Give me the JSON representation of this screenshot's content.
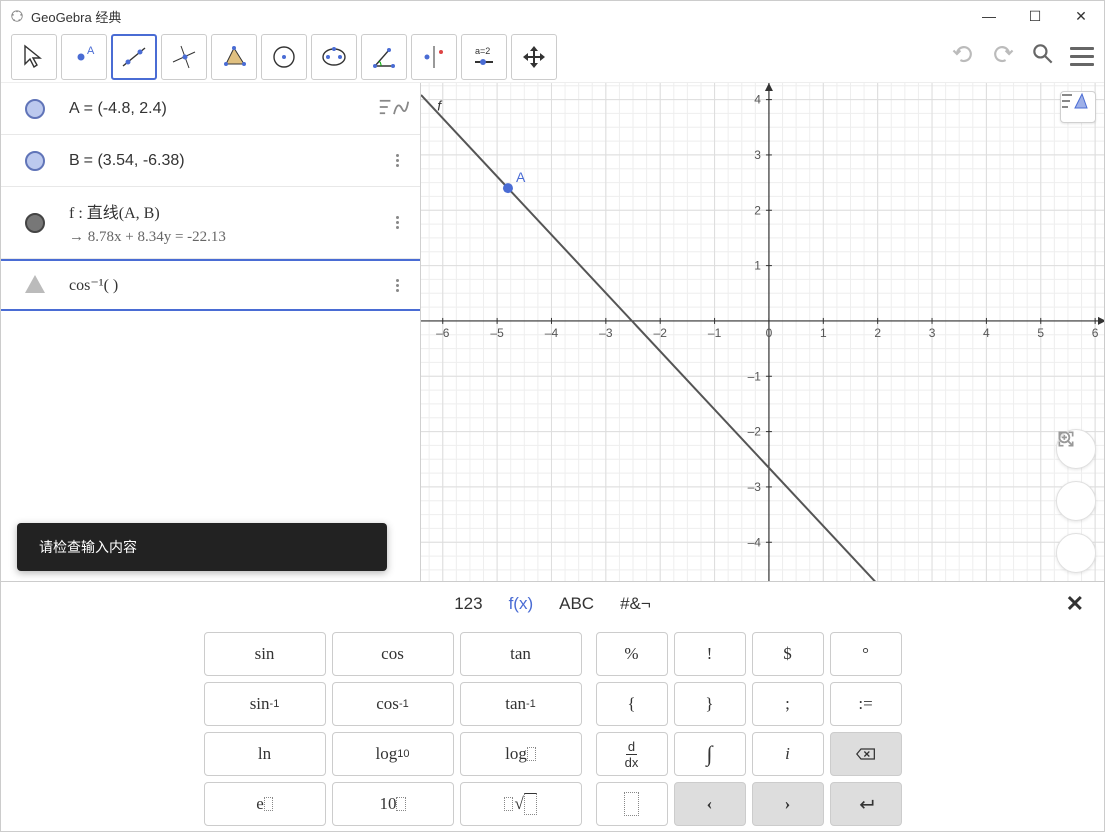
{
  "title": "GeoGebra 经典",
  "algebra": {
    "A": {
      "label": "A",
      "expr": "= (-4.8, 2.4)"
    },
    "B": {
      "label": "B",
      "expr": "= (3.54, -6.38)"
    },
    "f": {
      "label": "f : 直线(A, B)",
      "sub": "→  8.78x + 8.34y = -22.13"
    },
    "input": "cos⁻¹(  )"
  },
  "toast": "请检查输入内容",
  "kbtabs": [
    "123",
    "f(x)",
    "ABC",
    "#&¬"
  ],
  "keys1": [
    "sin",
    "cos",
    "tan",
    "sin⁻¹",
    "cos⁻¹",
    "tan⁻¹",
    "ln",
    "log₁₀",
    "log_",
    "e^",
    "10^",
    "√"
  ],
  "keys2": [
    "%",
    "!",
    "$",
    "°",
    "{",
    "}",
    ";",
    ":=",
    "d/dx",
    "∫",
    "i",
    "⌫",
    "⋯",
    "‹",
    "›",
    "⏎"
  ],
  "chart_data": {
    "type": "line",
    "title": "",
    "xlim": [
      -6.4,
      6.2
    ],
    "ylim": [
      -4.7,
      4.3
    ],
    "points": [
      {
        "name": "A",
        "x": -4.8,
        "y": 2.4
      }
    ],
    "line": {
      "equation": "8.78x + 8.34y = -22.13",
      "slope": -1.0528,
      "intercept": -2.654
    },
    "f_label": {
      "x": -6.1,
      "y": 3.8,
      "text": "f"
    }
  }
}
